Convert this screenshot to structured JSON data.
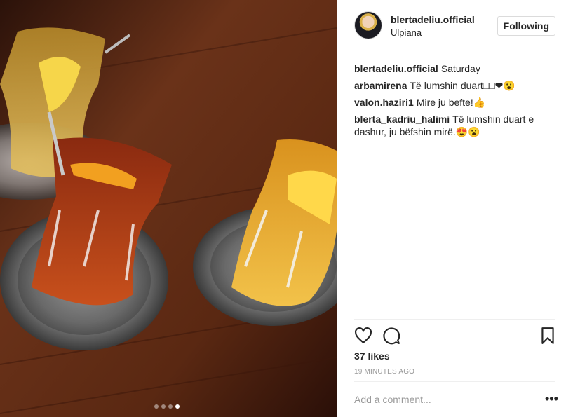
{
  "photo": {
    "carousel_dots": [
      false,
      false,
      false,
      true
    ]
  },
  "header": {
    "username": "blertadeliu.official",
    "location": "Ulpiana",
    "follow_label": "Following"
  },
  "comments": [
    {
      "user": "blertadeliu.official",
      "text": "Saturday"
    },
    {
      "user": "arbamirena",
      "text": "Të lumshin duart□□❤😮"
    },
    {
      "user": "valon.haziri1",
      "text": "Mire ju befte!👍"
    },
    {
      "user": "blerta_kadriu_halimi",
      "text": "Të lumshin duart e dashur, ju bëfshin mirë.😍😮"
    }
  ],
  "actions": {
    "icons": [
      "heart-icon",
      "comment-icon",
      "bookmark-icon"
    ]
  },
  "likes": "37 likes",
  "timestamp": "19 MINUTES AGO",
  "add_comment_placeholder": "Add a comment...",
  "more_label": "•••"
}
